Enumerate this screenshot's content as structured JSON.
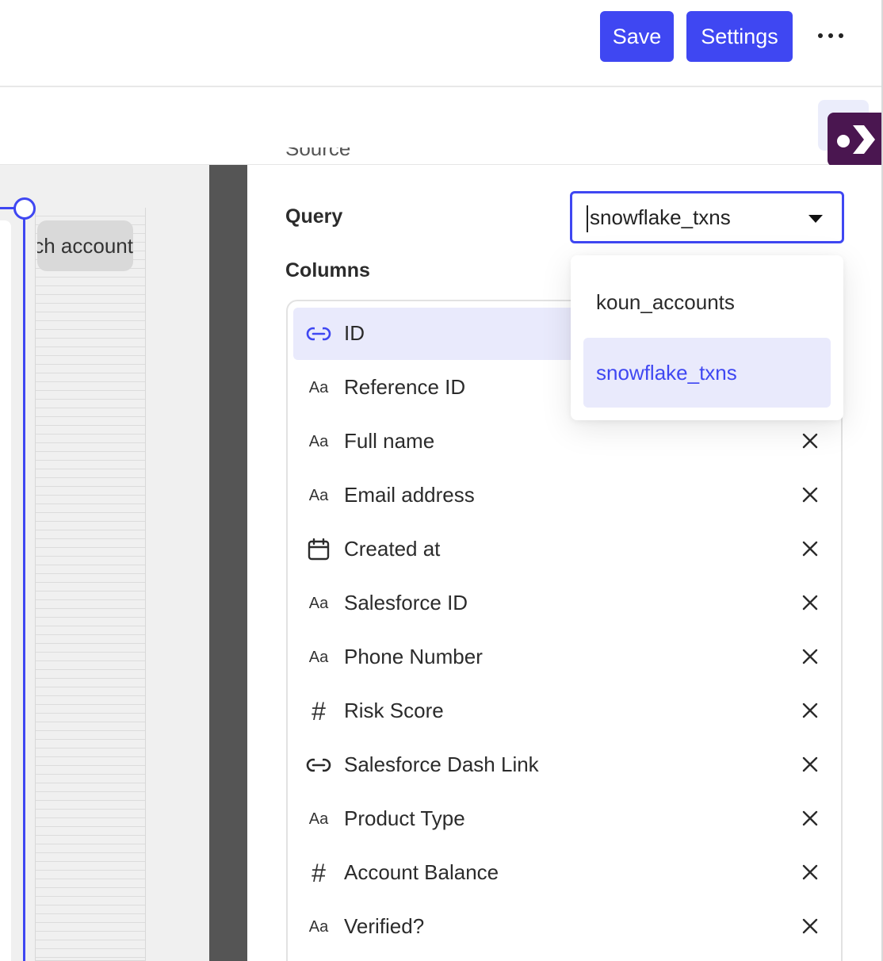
{
  "toolbar": {
    "save_label": "Save",
    "settings_label": "Settings"
  },
  "canvas": {
    "node_label": "each account"
  },
  "panel": {
    "section_cut_label": "Source",
    "query_label": "Query",
    "query_value": "snowflake_txns",
    "columns_label": "Columns"
  },
  "dropdown": {
    "options": [
      "koun_accounts",
      "snowflake_txns"
    ],
    "selected": "snowflake_txns"
  },
  "columns": [
    {
      "name": "ID",
      "type_icon": "link-icon",
      "selected": true
    },
    {
      "name": "Reference ID",
      "type_icon": "text-type-icon",
      "type_glyph": "Aa"
    },
    {
      "name": "Full name",
      "type_icon": "text-type-icon",
      "type_glyph": "Aa"
    },
    {
      "name": "Email address",
      "type_icon": "text-type-icon",
      "type_glyph": "Aa"
    },
    {
      "name": "Created at",
      "type_icon": "calendar-icon"
    },
    {
      "name": "Salesforce ID",
      "type_icon": "text-type-icon",
      "type_glyph": "Aa"
    },
    {
      "name": "Phone Number",
      "type_icon": "text-type-icon",
      "type_glyph": "Aa"
    },
    {
      "name": "Risk Score",
      "type_icon": "number-type-icon",
      "type_glyph": "#"
    },
    {
      "name": "Salesforce Dash Link",
      "type_icon": "link-icon"
    },
    {
      "name": "Product Type",
      "type_icon": "text-type-icon",
      "type_glyph": "Aa"
    },
    {
      "name": "Account Balance",
      "type_icon": "number-type-icon",
      "type_glyph": "#"
    },
    {
      "name": "Verified?",
      "type_icon": "text-type-icon",
      "type_glyph": "Aa"
    }
  ],
  "colors": {
    "accent": "#3f47f2",
    "accent_light": "#e9eafc",
    "brand": "#4a1650",
    "divider": "#555555"
  }
}
